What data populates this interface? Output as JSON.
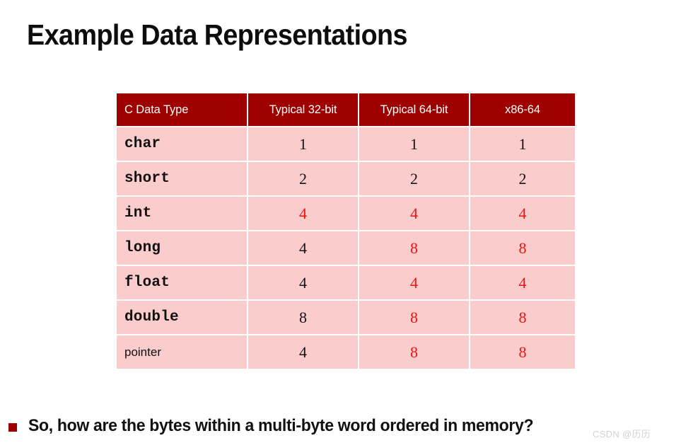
{
  "slide": {
    "title": "Example Data Representations"
  },
  "table": {
    "columns": [
      "C Data Type",
      "Typical 32-bit",
      "Typical 64-bit",
      "x86-64"
    ],
    "rows": [
      {
        "type": "char",
        "mono": true,
        "bit32": "1",
        "bit64": "1",
        "x8664": "1",
        "highlight32": false,
        "highlight64": false,
        "highlightX86": false
      },
      {
        "type": "short",
        "mono": true,
        "bit32": "2",
        "bit64": "2",
        "x8664": "2",
        "highlight32": false,
        "highlight64": false,
        "highlightX86": false
      },
      {
        "type": "int",
        "mono": true,
        "bit32": "4",
        "bit64": "4",
        "x8664": "4",
        "highlight32": true,
        "highlight64": true,
        "highlightX86": true
      },
      {
        "type": "long",
        "mono": true,
        "bit32": "4",
        "bit64": "8",
        "x8664": "8",
        "highlight32": false,
        "highlight64": true,
        "highlightX86": true
      },
      {
        "type": "float",
        "mono": true,
        "bit32": "4",
        "bit64": "4",
        "x8664": "4",
        "highlight32": false,
        "highlight64": true,
        "highlightX86": true
      },
      {
        "type": "double",
        "mono": true,
        "bit32": "8",
        "bit64": "8",
        "x8664": "8",
        "highlight32": false,
        "highlight64": true,
        "highlightX86": true
      },
      {
        "type": "pointer",
        "mono": false,
        "bit32": "4",
        "bit64": "8",
        "x8664": "8",
        "highlight32": false,
        "highlight64": true,
        "highlightX86": true
      }
    ]
  },
  "footer": {
    "bullet_text": "So, how are the bytes within a multi-byte word ordered in memory?"
  },
  "watermark": {
    "text": "CSDN @历历"
  },
  "colors": {
    "header_bg": "#9e0000",
    "cell_bg": "#fbcccc",
    "highlight_text": "#ee1111",
    "normal_text": "#141414",
    "bullet": "#9e0000"
  }
}
